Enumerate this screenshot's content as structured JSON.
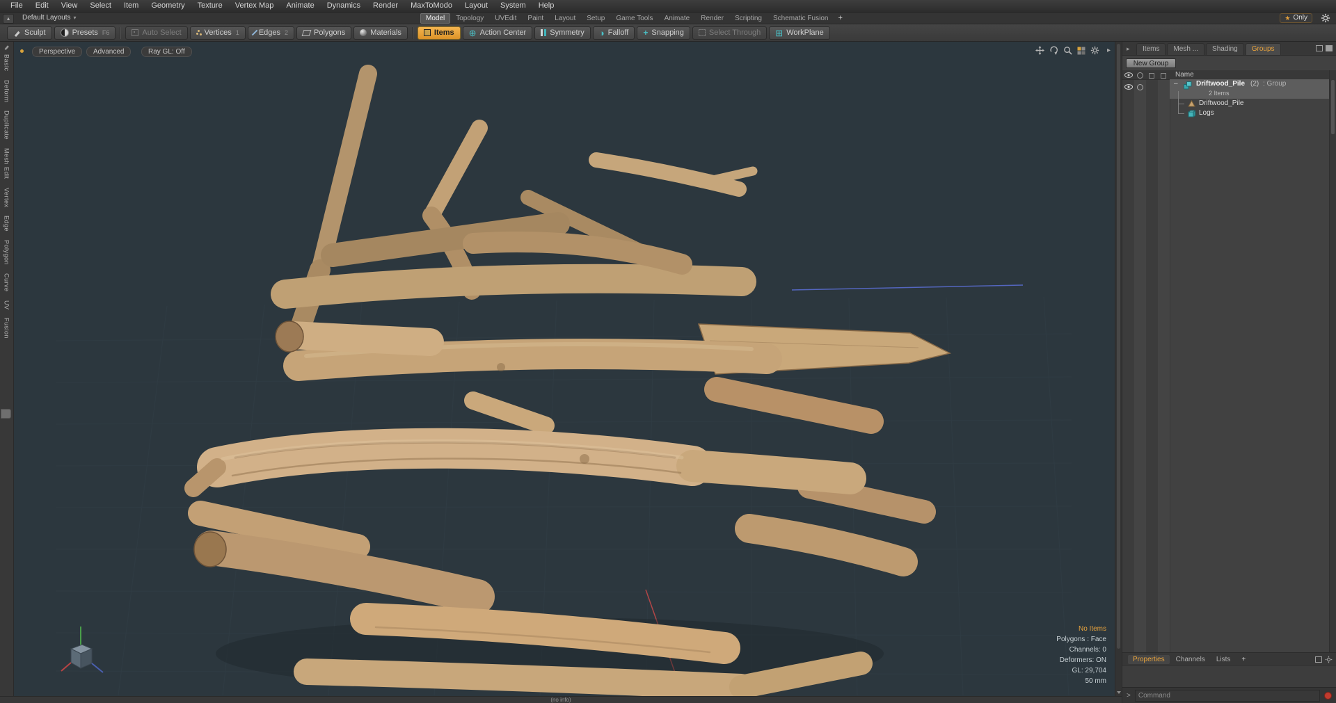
{
  "window": {
    "status_text": "(no info)"
  },
  "menubar": {
    "items": [
      "File",
      "Edit",
      "View",
      "Select",
      "Item",
      "Geometry",
      "Texture",
      "Vertex Map",
      "Animate",
      "Dynamics",
      "Render",
      "MaxToModo",
      "Layout",
      "System",
      "Help"
    ]
  },
  "layout_bar": {
    "switcher_label": "Default Layouts",
    "tabs": [
      "Model",
      "Topology",
      "UVEdit",
      "Paint",
      "Layout",
      "Setup",
      "Game Tools",
      "Animate",
      "Render",
      "Scripting",
      "Schematic Fusion"
    ],
    "add_tab": "+",
    "active_tab": "Model",
    "only_label": "Only"
  },
  "toolbar": {
    "sculpt": "Sculpt",
    "presets": "Presets",
    "presets_shortcut": "F6",
    "auto_select": "Auto Select",
    "vertices": "Vertices",
    "vertices_shortcut": "1",
    "edges": "Edges",
    "edges_shortcut": "2",
    "polygons": "Polygons",
    "materials": "Materials",
    "items": "Items",
    "action_center": "Action Center",
    "symmetry": "Symmetry",
    "falloff": "Falloff",
    "snapping": "Snapping",
    "select_through": "Select Through",
    "workplane": "WorkPlane"
  },
  "left_tabs": {
    "items": [
      "Basic",
      "Deform",
      "Duplicate",
      "Mesh Edit",
      "Vertex",
      "Edge",
      "Polygon",
      "Curve",
      "UV",
      "Fusion"
    ]
  },
  "viewport": {
    "mode_buttons": [
      "Perspective",
      "Advanced",
      "Ray GL: Off"
    ],
    "stats": {
      "no_items": "No Items",
      "polygons": "Polygons : Face",
      "channels": "Channels: 0",
      "deformers": "Deformers: ON",
      "gl": "GL: 29,704",
      "grid_size": "50 mm"
    }
  },
  "right_panel": {
    "tabs": [
      "Items",
      "Mesh ...",
      "Shading",
      "Groups"
    ],
    "active_tab": "Groups",
    "new_group_label": "New Group",
    "tree": {
      "name_header": "Name",
      "group_name": "Driftwood_Pile",
      "group_count": "(2)",
      "group_suffix": ": Group",
      "group_items": "2 Items",
      "child1": "Driftwood_Pile",
      "child2": "Logs"
    },
    "bottom_tabs": [
      "Properties",
      "Channels",
      "Lists"
    ],
    "bottom_add": "+",
    "active_bottom_tab": "Properties",
    "command_prompt": ">",
    "command_placeholder": "Command"
  },
  "colors": {
    "accent_orange": "#e8a33d",
    "viewport_bg": "#2c373e",
    "wood_light": "#d2b189",
    "wood_dark": "#a8865e",
    "axis_blue": "#5b6fd6",
    "axis_red": "#c24848",
    "teal_icon": "#49c0c6",
    "record_red": "#c23b2e"
  }
}
